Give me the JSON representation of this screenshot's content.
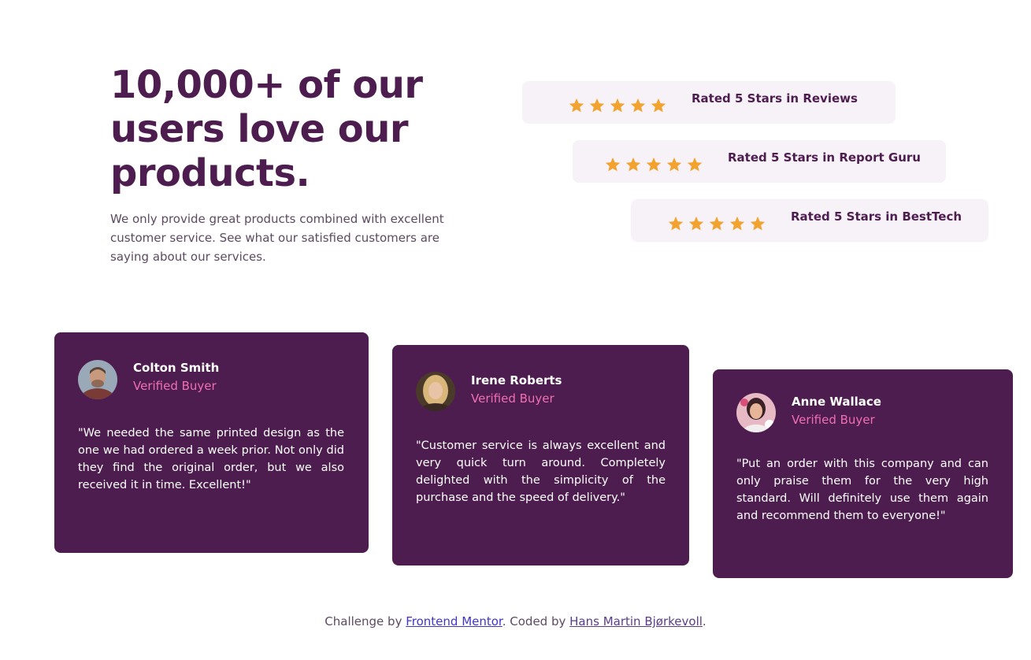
{
  "hero": {
    "title": "10,000+ of our users love our products.",
    "text": "We only provide great products combined with excellent customer service. See what our satisfied customers are saying about our services."
  },
  "ratings": [
    {
      "label": "Rated 5 Stars in Reviews",
      "stars": 5
    },
    {
      "label": "Rated 5 Stars in Report Guru",
      "stars": 5
    },
    {
      "label": "Rated 5 Stars in BestTech",
      "stars": 5
    }
  ],
  "testimonials": [
    {
      "name": "Colton Smith",
      "role": "Verified Buyer",
      "quote": "\"We needed the same printed design as the one we had ordered a week prior. Not only did they find the original order, but we also received it in time. Excellent!\""
    },
    {
      "name": "Irene Roberts",
      "role": "Verified Buyer",
      "quote": "\"Customer service is always excellent and very quick turn around. Completely delighted with the simplicity of the purchase and the speed of delivery.\""
    },
    {
      "name": "Anne Wallace",
      "role": "Verified Buyer",
      "quote": "\"Put an order with this company and can only praise them for the very high standard. Will definitely use them again and recommend them to everyone!\""
    }
  ],
  "footer": {
    "prefix": "Challenge by ",
    "link1": "Frontend Mentor",
    "middle": ". Coded by ",
    "link2": "Hans Martin Bjørkevoll",
    "suffix": "."
  },
  "colors": {
    "primary": "#4d1d4f",
    "accent_pink": "#ef6fb3",
    "star": "#f2a32f",
    "rating_bg": "#f7f1f8"
  },
  "icons": {
    "star": "star-icon",
    "avatar": "avatar"
  }
}
